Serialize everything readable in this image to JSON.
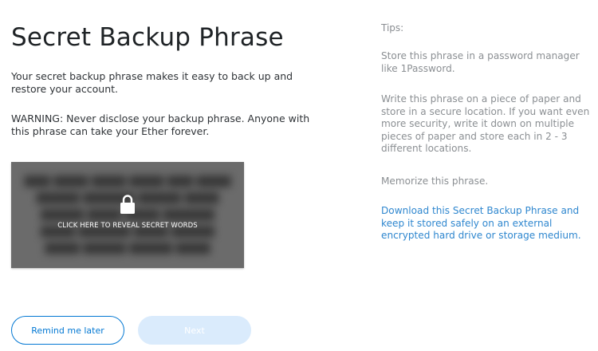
{
  "title": "Secret Backup Phrase",
  "intro": "Your secret backup phrase makes it easy to back up and restore your account.",
  "warning": "WARNING: Never disclose your backup phrase. Anyone with this phrase can take your Ether forever.",
  "reveal": {
    "label": "CLICK HERE TO REVEAL SECRET WORDS",
    "icon": "lock-icon"
  },
  "buttons": {
    "remind_label": "Remind me later",
    "next_label": "Next",
    "next_disabled": true
  },
  "tips": {
    "heading": "Tips:",
    "items": [
      "Store this phrase in a password manager like 1Password.",
      "Write this phrase on a piece of paper and store in a secure location. If you want even more security, write it down on multiple pieces of paper and store each in 2 - 3 different locations.",
      "Memorize this phrase."
    ],
    "download_link": "Download this Secret Backup Phrase and keep it stored safely on an external encrypted hard drive or storage medium."
  },
  "colors": {
    "accent": "#0378d3",
    "link": "#2f87cf",
    "next_disabled_bg": "#daebfc",
    "reveal_overlay": "#6b6b6b",
    "muted_text": "#8b8f93"
  }
}
